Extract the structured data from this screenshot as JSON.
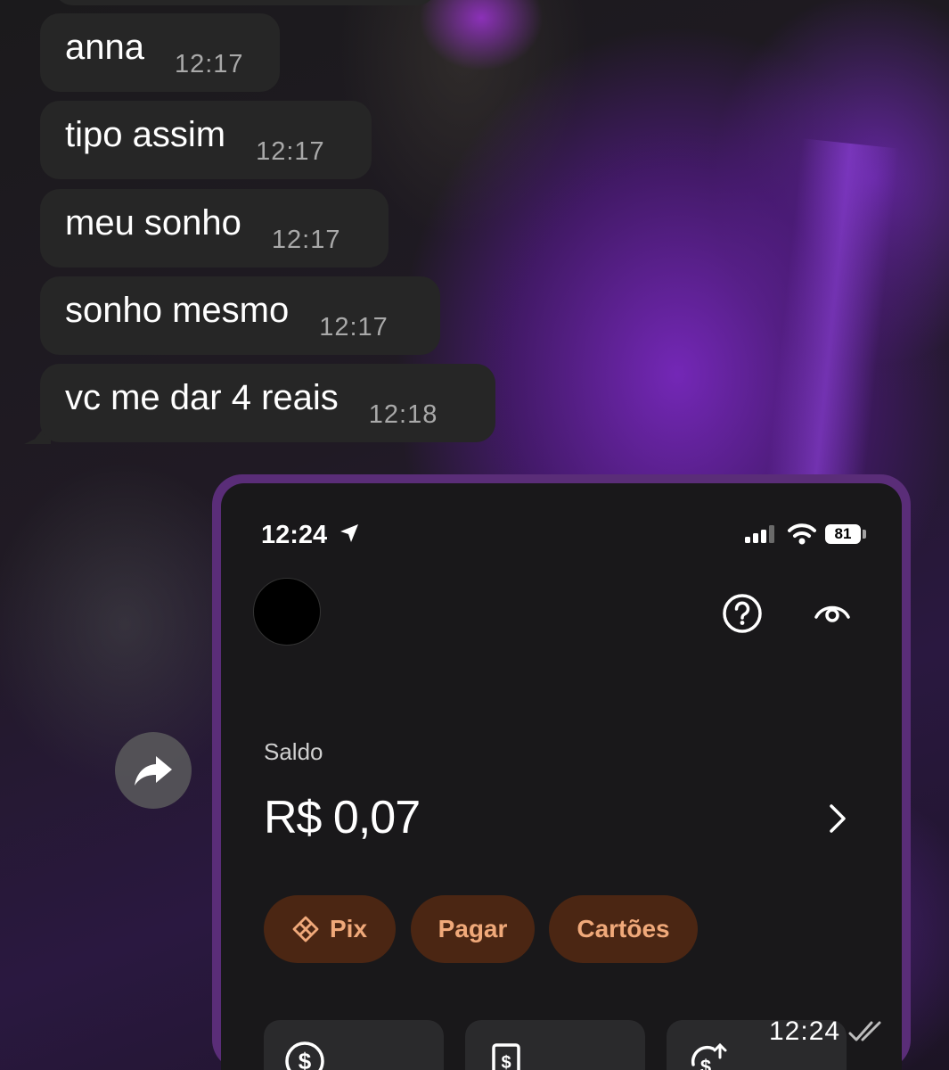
{
  "messages": [
    {
      "text": "anna",
      "time": "12:17"
    },
    {
      "text": "tipo assim",
      "time": "12:17"
    },
    {
      "text": "meu sonho",
      "time": "12:17"
    },
    {
      "text": "sonho mesmo",
      "time": "12:17"
    },
    {
      "text": "vc me dar 4 reais",
      "time": "12:18"
    }
  ],
  "forward": {
    "icon": "forward-arrow-icon"
  },
  "screenshot": {
    "status_bar": {
      "time": "12:24",
      "battery": "81",
      "icons": [
        "location-arrow-icon",
        "signal-icon",
        "wifi-icon",
        "battery-icon"
      ]
    },
    "header_icons": [
      "help-circle-icon",
      "eye-icon"
    ],
    "balance": {
      "label": "Saldo",
      "value": "R$ 0,07"
    },
    "actions": [
      {
        "label": "Pix",
        "icon": "pix-icon"
      },
      {
        "label": "Pagar"
      },
      {
        "label": "Cartões"
      }
    ],
    "cards": [
      {
        "icon": "dollar-circle-icon"
      },
      {
        "icon": "barcode-card-icon"
      },
      {
        "icon": "money-transfer-icon"
      }
    ]
  },
  "media_message": {
    "time": "12:24",
    "status": "read-double-check-icon"
  },
  "colors": {
    "bubble": "#262626",
    "frame": "#5a2d78",
    "pill_bg": "#4b2613",
    "pill_text": "#f0a97a"
  }
}
